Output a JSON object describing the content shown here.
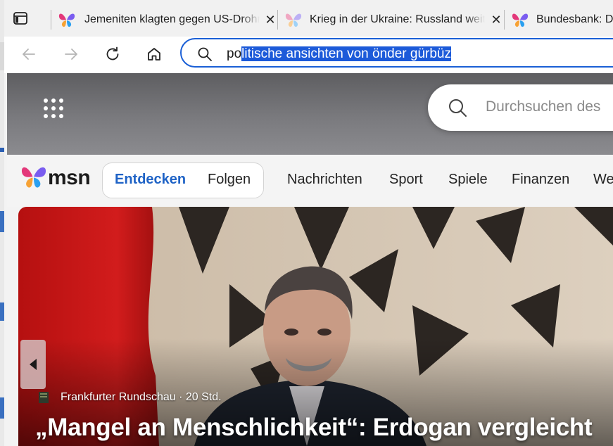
{
  "browser": {
    "tabs": [
      {
        "title": "Jemeniten klagten gegen US-Drohnen",
        "close": "✕"
      },
      {
        "title": "Krieg in der Ukraine: Russland weitet",
        "close": "✕"
      },
      {
        "title": "Bundesbank: Deutschland",
        "close": ""
      }
    ],
    "address_bar": {
      "text_unselected": "po",
      "text_selected": "litische ansichten von önder gürbüz"
    },
    "icons": {
      "tab_panel": "tab-panel-icon",
      "back": "back-arrow-icon",
      "forward": "forward-arrow-icon",
      "refresh": "refresh-icon",
      "home": "home-icon",
      "search": "search-icon"
    }
  },
  "msn": {
    "logo_text": "msn",
    "search_placeholder": "Durchsuchen des",
    "nav": {
      "discover": "Entdecken",
      "follow": "Folgen",
      "items": [
        "Nachrichten",
        "Sport",
        "Spiele",
        "Finanzen",
        "We"
      ]
    },
    "hero": {
      "source": "Frankfurter Rundschau",
      "age": "· 20 Std.",
      "headline": "„Mangel an Menschlichkeit“: Erdogan vergleicht"
    }
  },
  "colors": {
    "accent": "#1a5fd6",
    "selection": "#1c5ad9",
    "discover_text": "#1f63c6"
  }
}
